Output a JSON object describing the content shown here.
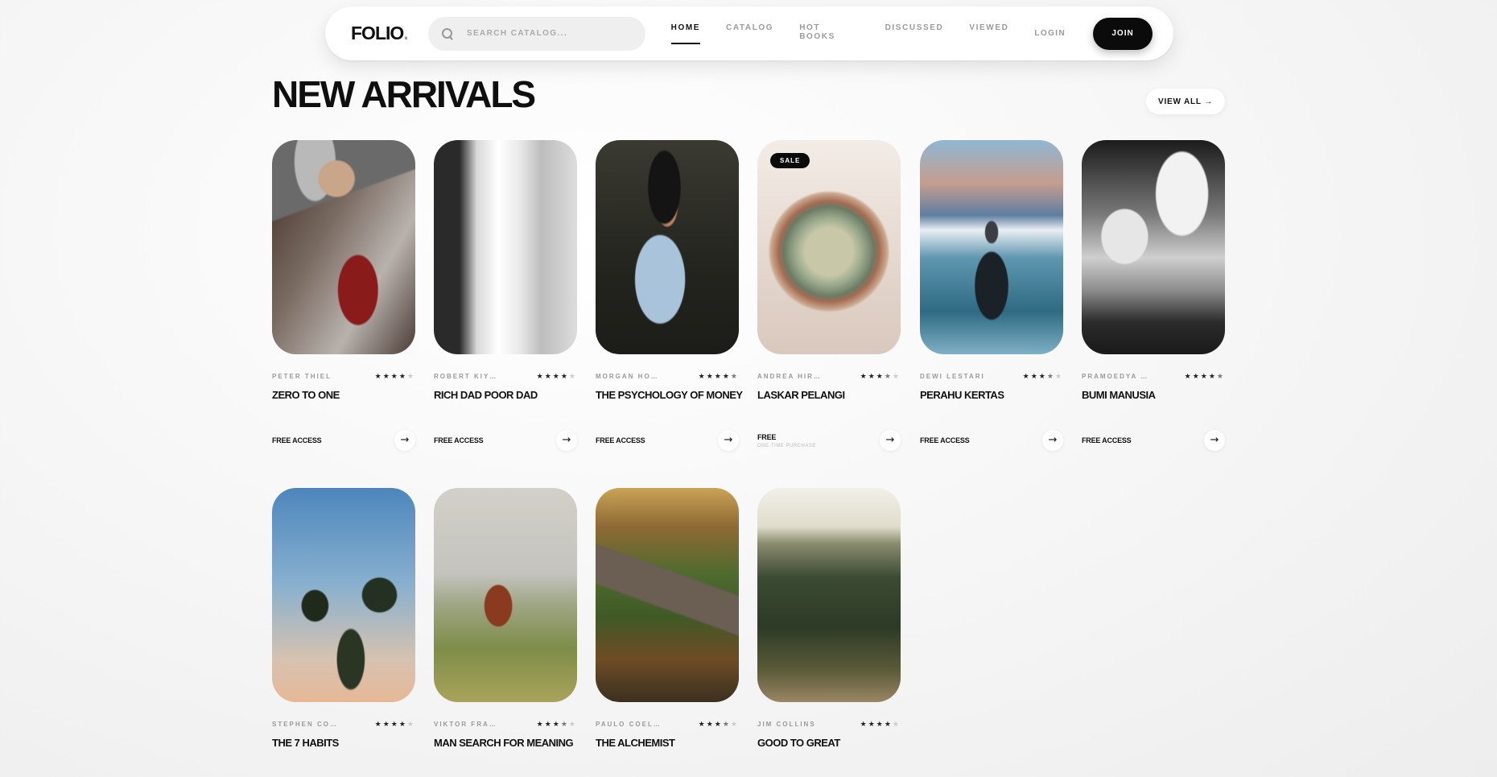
{
  "nav": {
    "logo": "FOLIO",
    "logo_dot": ".",
    "search_placeholder": "SEARCH CATALOG...",
    "links": [
      "HOME",
      "CATALOG",
      "HOT BOOKS",
      "DISCUSSED",
      "VIEWED"
    ],
    "active_link": "HOME",
    "login": "LOGIN",
    "join": "JOIN"
  },
  "section": {
    "title": "NEW ARRIVALS",
    "view_all": "VIEW ALL →"
  },
  "books": [
    {
      "author": "PETER THIEL",
      "title": "ZERO TO ONE",
      "rating": 4,
      "access": "FREE ACCESS",
      "sub": "",
      "sale": false,
      "cover": "guitar-woman"
    },
    {
      "author": "ROBERT KIY…",
      "title": "RICH DAD POOR DAD",
      "rating": 4,
      "access": "FREE ACCESS",
      "sub": "",
      "sale": false,
      "cover": "waterfall"
    },
    {
      "author": "MORGAN HO…",
      "title": "THE PSYCHOLOGY OF MONEY",
      "rating": 4.5,
      "access": "FREE ACCESS",
      "sub": "",
      "sale": false,
      "cover": "woman-reading"
    },
    {
      "author": "ANDREA HIR…",
      "title": "LASKAR PELANGI",
      "rating": 3.5,
      "access": "FREE",
      "sub": "ONE-TIME PURCHASE",
      "sale": true,
      "sale_label": "SALE",
      "cover": "cactus"
    },
    {
      "author": "DEWI LESTARI",
      "title": "PERAHU KERTAS",
      "rating": 3.5,
      "access": "FREE ACCESS",
      "sub": "",
      "sale": false,
      "cover": "mountain-lake"
    },
    {
      "author": "PRAMOEDYA …",
      "title": "BUMI MANUSIA",
      "rating": 4.5,
      "access": "FREE ACCESS",
      "sub": "",
      "sale": false,
      "cover": "clouds"
    },
    {
      "author": "STEPHEN CO…",
      "title": "THE 7 HABITS",
      "rating": 4,
      "access": "",
      "sub": "",
      "sale": false,
      "cover": "palm-trees"
    },
    {
      "author": "VIKTOR FRA…",
      "title": "MAN SEARCH FOR MEANING",
      "rating": 3.5,
      "access": "",
      "sub": "",
      "sale": false,
      "cover": "harvester"
    },
    {
      "author": "PAULO COEL…",
      "title": "THE ALCHEMIST",
      "rating": 3.5,
      "access": "",
      "sub": "",
      "sale": false,
      "cover": "forest-hill"
    },
    {
      "author": "JIM COLLINS",
      "title": "GOOD TO GREAT",
      "rating": 4,
      "access": "",
      "sub": "",
      "sale": false,
      "cover": "valley"
    }
  ],
  "icons": {
    "search": "search-icon",
    "arrow": "arrow-right-icon",
    "star": "star-icon"
  },
  "colors": {
    "accent": "#0b0b0b",
    "muted": "#9a9a9a",
    "background": "#f4f4f4"
  }
}
